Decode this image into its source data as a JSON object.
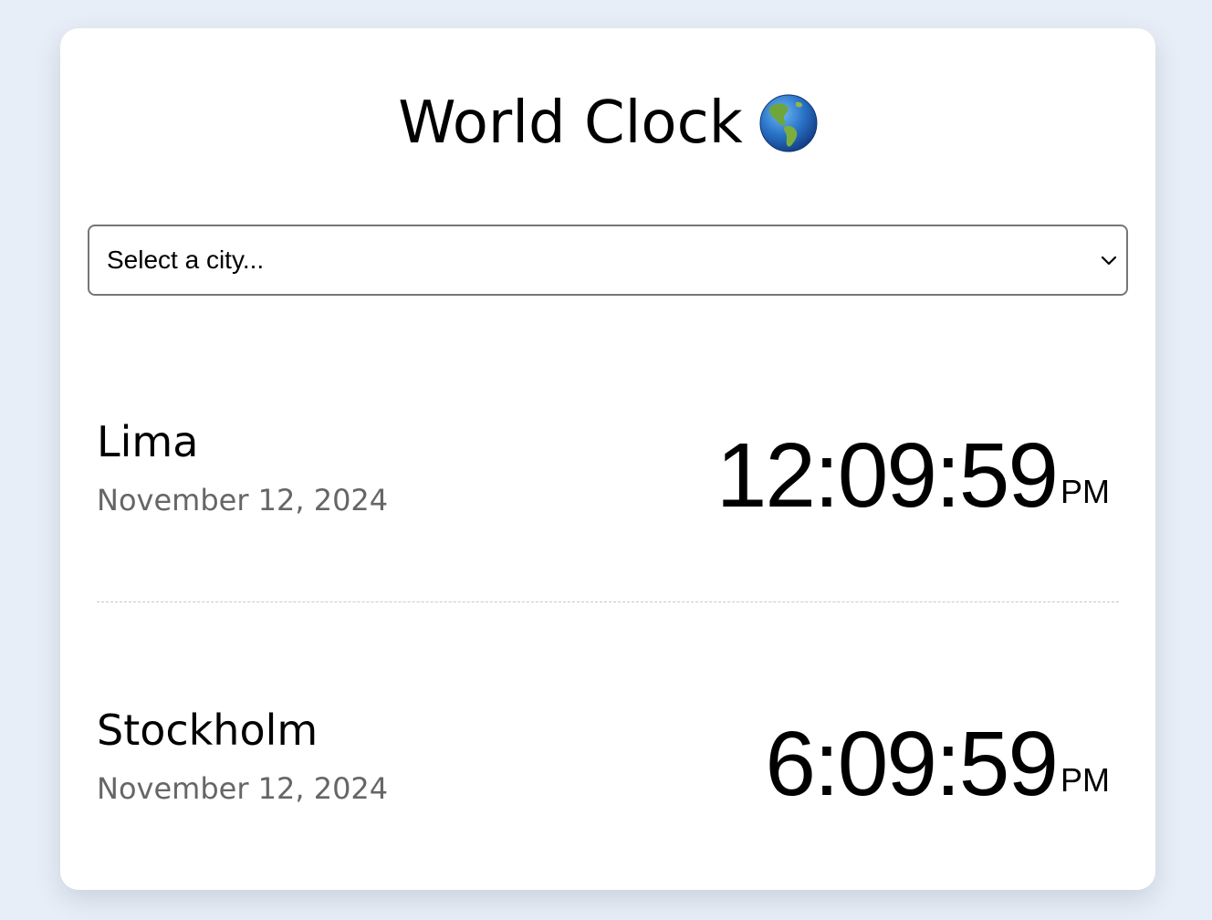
{
  "app": {
    "title": "World Clock",
    "title_icon": "globe-americas-icon"
  },
  "city_select": {
    "placeholder": "Select a city...",
    "icon": "chevron-down-icon"
  },
  "clocks": [
    {
      "city": "Lima",
      "date": "November 12, 2024",
      "time": "12:09:59",
      "period": "PM"
    },
    {
      "city": "Stockholm",
      "date": "November 12, 2024",
      "time": "6:09:59",
      "period": "PM"
    }
  ],
  "colors": {
    "page_background": "#e8eef7",
    "card_background": "#ffffff",
    "date_text": "#666666",
    "divider": "#c8c8c8"
  }
}
